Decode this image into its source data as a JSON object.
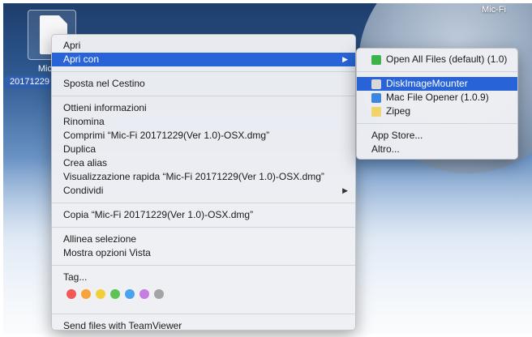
{
  "desktop": {
    "volume_label": "Mic-Fi",
    "file_label_line1": "Mic",
    "file_label_line2": "20171229"
  },
  "context_menu": {
    "items": [
      {
        "label": "Apri"
      },
      {
        "label": "Apri con"
      },
      {
        "label": "Sposta nel Cestino"
      },
      {
        "label": "Ottieni informazioni"
      },
      {
        "label": "Rinomina"
      },
      {
        "label": "Comprimi “Mic-Fi 20171229(Ver 1.0)-OSX.dmg”"
      },
      {
        "label": "Duplica"
      },
      {
        "label": "Crea alias"
      },
      {
        "label": "Visualizzazione rapida “Mic-Fi 20171229(Ver 1.0)-OSX.dmg”"
      },
      {
        "label": "Condividi"
      },
      {
        "label": "Copia “Mic-Fi 20171229(Ver 1.0)-OSX.dmg”"
      },
      {
        "label": "Allinea selezione"
      },
      {
        "label": "Mostra opzioni Vista"
      },
      {
        "label": "Tag..."
      },
      {
        "label": "Send files with TeamViewer"
      }
    ],
    "tag_colors": [
      "#f25a5a",
      "#f7a23b",
      "#f2cf3a",
      "#5fc257",
      "#4aa3ee",
      "#c67ee0",
      "#a4a4a6"
    ]
  },
  "submenu": {
    "items": [
      {
        "label": "Open All Files (default) (1.0)",
        "icon": "green-app-icon",
        "color": "#3bb54a"
      },
      {
        "label": "DiskImageMounter",
        "icon": "disk-image-icon",
        "color": "#d9d9d9"
      },
      {
        "label": "Mac File Opener (1.0.9)",
        "icon": "file-opener-icon",
        "color": "#3a86e0"
      },
      {
        "label": "Zipeg",
        "icon": "zipeg-icon",
        "color": "#f0d36a"
      },
      {
        "label": "App Store..."
      },
      {
        "label": "Altro..."
      }
    ]
  }
}
